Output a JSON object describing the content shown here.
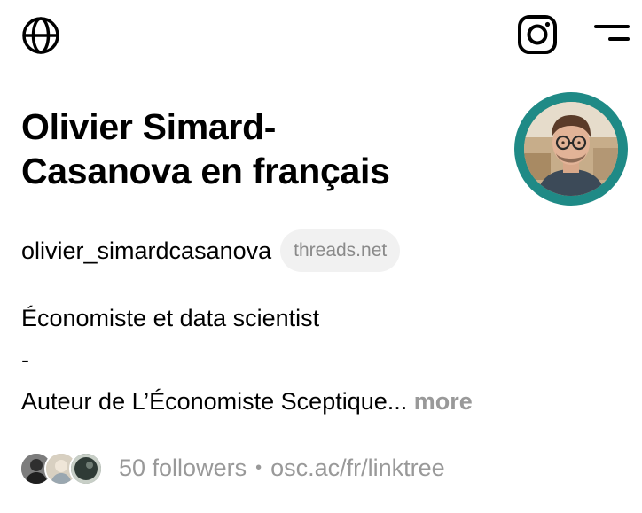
{
  "header": {
    "globe_icon": "globe-icon",
    "instagram_icon": "instagram-icon",
    "menu_icon": "menu-icon"
  },
  "profile": {
    "name_line1": "Olivier Simard-",
    "name_line2": "Casanova en français",
    "username": "olivier_simardcasanova",
    "domain_badge": "threads.net",
    "avatar_ring_color": "#1f8a86",
    "bio": {
      "line1": "Économiste et data scientist",
      "line2": "-",
      "line3": "Auteur de L’Économiste Sceptique...",
      "more_label": "more"
    },
    "followers_label": "50 followers",
    "separator": "•",
    "link": "osc.ac/fr/linktree"
  }
}
